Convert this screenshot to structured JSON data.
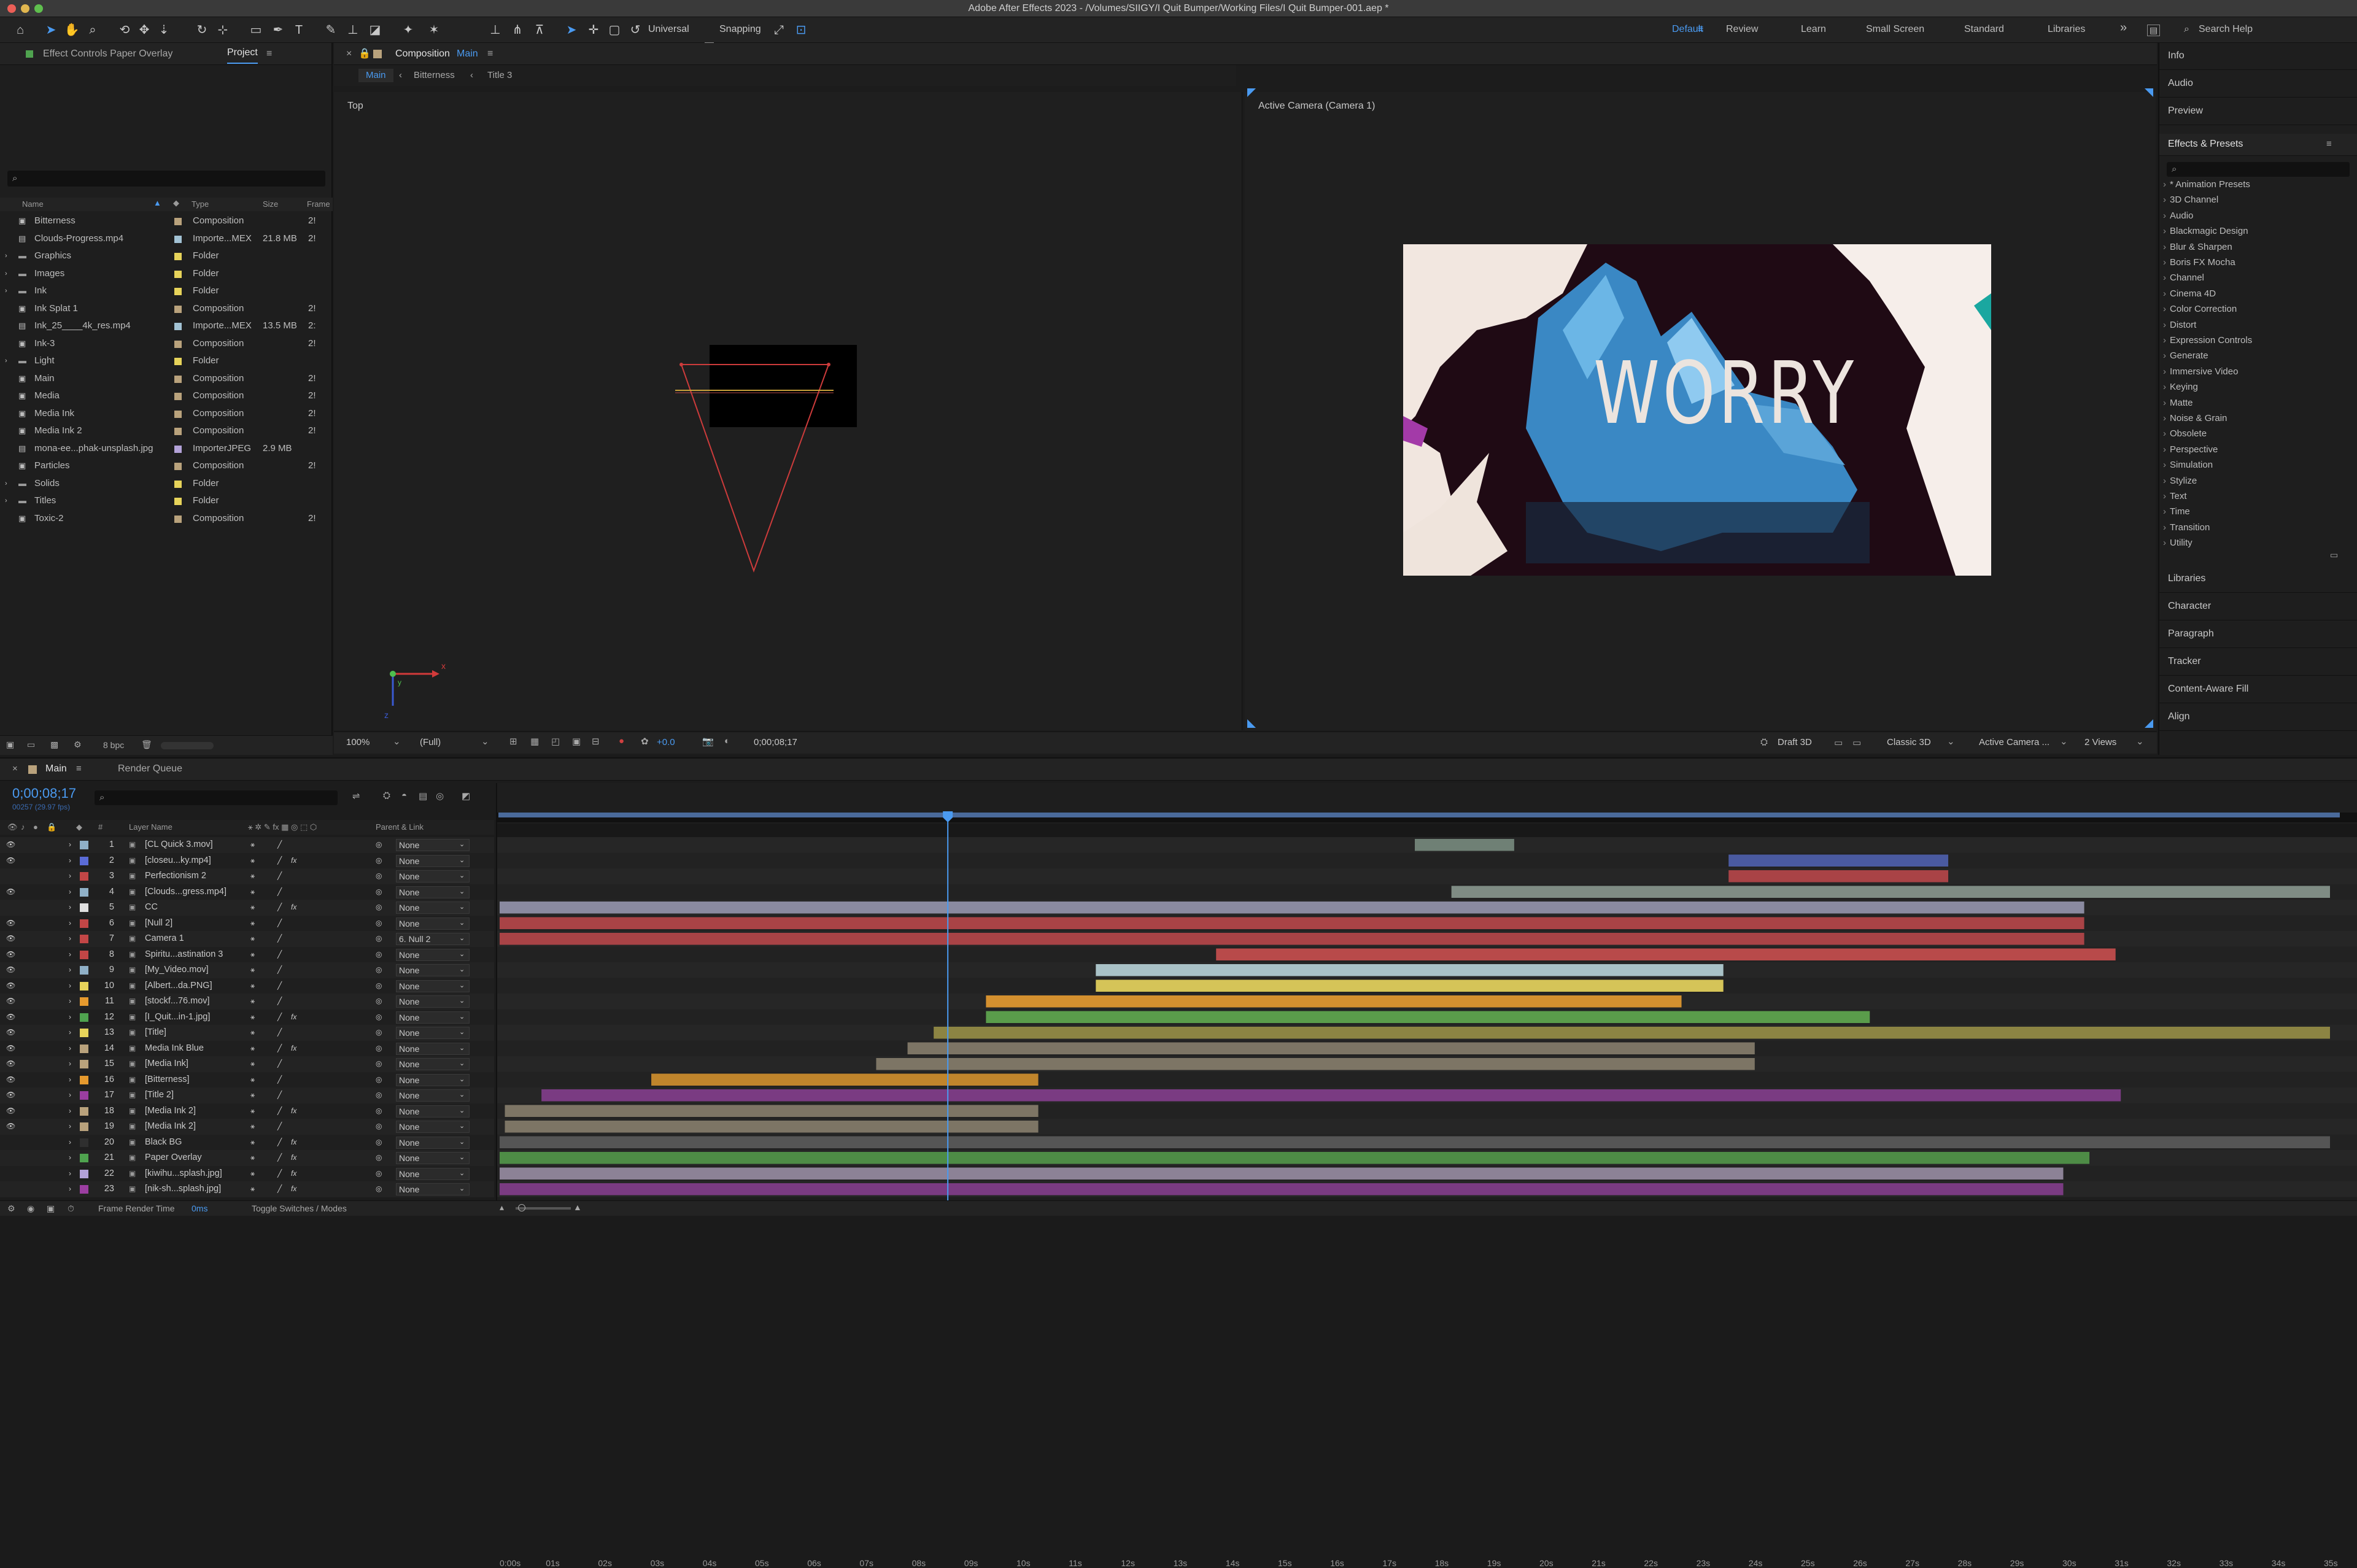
{
  "window": {
    "title": "Adobe After Effects 2023 - /Volumes/SIIGY/I Quit Bumper/Working Files/I Quit Bumper-001.aep *"
  },
  "toolbar": {
    "universal": "Universal",
    "snapping": "Snapping",
    "workspaces": [
      "Default",
      "Review",
      "Learn",
      "Small Screen",
      "Standard",
      "Libraries"
    ],
    "search_placeholder": "Search Help"
  },
  "left_panel": {
    "tab_effect_controls": "Effect Controls Paper Overlay",
    "tab_project": "Project",
    "columns": [
      "Name",
      "Type",
      "Size",
      "Frame"
    ],
    "bpc": "8 bpc",
    "items": [
      {
        "name": "Bitterness",
        "type": "Composition",
        "size": "",
        "frame": "2!",
        "color": "#b9a27c",
        "kind": "comp"
      },
      {
        "name": "Clouds-Progress.mp4",
        "type": "Importe...MEX",
        "size": "21.8 MB",
        "frame": "2!",
        "color": "#a2c2d4",
        "kind": "file"
      },
      {
        "name": "Graphics",
        "type": "Folder",
        "size": "",
        "frame": "",
        "color": "#e6d35a",
        "kind": "folder"
      },
      {
        "name": "Images",
        "type": "Folder",
        "size": "",
        "frame": "",
        "color": "#e6d35a",
        "kind": "folder"
      },
      {
        "name": "Ink",
        "type": "Folder",
        "size": "",
        "frame": "",
        "color": "#e6d35a",
        "kind": "folder"
      },
      {
        "name": "Ink Splat 1",
        "type": "Composition",
        "size": "",
        "frame": "2!",
        "color": "#b9a27c",
        "kind": "comp"
      },
      {
        "name": "Ink_25____4k_res.mp4",
        "type": "Importe...MEX",
        "size": "13.5 MB",
        "frame": "2:",
        "color": "#a2c2d4",
        "kind": "file"
      },
      {
        "name": "Ink-3",
        "type": "Composition",
        "size": "",
        "frame": "2!",
        "color": "#b9a27c",
        "kind": "comp"
      },
      {
        "name": "Light",
        "type": "Folder",
        "size": "",
        "frame": "",
        "color": "#e6d35a",
        "kind": "folder"
      },
      {
        "name": "Main",
        "type": "Composition",
        "size": "",
        "frame": "2!",
        "color": "#b9a27c",
        "kind": "comp"
      },
      {
        "name": "Media",
        "type": "Composition",
        "size": "",
        "frame": "2!",
        "color": "#b9a27c",
        "kind": "comp"
      },
      {
        "name": "Media Ink",
        "type": "Composition",
        "size": "",
        "frame": "2!",
        "color": "#b9a27c",
        "kind": "comp"
      },
      {
        "name": "Media Ink 2",
        "type": "Composition",
        "size": "",
        "frame": "2!",
        "color": "#b9a27c",
        "kind": "comp"
      },
      {
        "name": "mona-ee...phak-unsplash.jpg",
        "type": "ImporterJPEG",
        "size": "2.9 MB",
        "frame": "",
        "color": "#b3a2d8",
        "kind": "file"
      },
      {
        "name": "Particles",
        "type": "Composition",
        "size": "",
        "frame": "2!",
        "color": "#b9a27c",
        "kind": "comp"
      },
      {
        "name": "Solids",
        "type": "Folder",
        "size": "",
        "frame": "",
        "color": "#e6d35a",
        "kind": "folder"
      },
      {
        "name": "Titles",
        "type": "Folder",
        "size": "",
        "frame": "",
        "color": "#e6d35a",
        "kind": "folder"
      },
      {
        "name": "Toxic-2",
        "type": "Composition",
        "size": "",
        "frame": "2!",
        "color": "#b9a27c",
        "kind": "comp"
      }
    ]
  },
  "comp_panel": {
    "tab_prefix": "Composition",
    "comp_name": "Main",
    "breadcrumbs": [
      "Main",
      "Bitterness",
      "Title 3"
    ],
    "view_left": "Top",
    "view_right": "Active Camera (Camera 1)",
    "worry_text": "WORRY",
    "footer": {
      "zoom": "100%",
      "resolution": "(Full)",
      "exposure": "+0.0",
      "timecode": "0;00;08;17",
      "draft": "Draft 3D",
      "renderer": "Classic 3D",
      "camera": "Active Camera ...",
      "views": "2 Views"
    }
  },
  "right_panel": {
    "top": [
      "Info",
      "Audio",
      "Preview"
    ],
    "effects_title": "Effects & Presets",
    "effects": [
      "* Animation Presets",
      "3D Channel",
      "Audio",
      "Blackmagic Design",
      "Blur & Sharpen",
      "Boris FX Mocha",
      "Channel",
      "Cinema 4D",
      "Color Correction",
      "Distort",
      "Expression Controls",
      "Generate",
      "Immersive Video",
      "Keying",
      "Matte",
      "Noise & Grain",
      "Obsolete",
      "Perspective",
      "Simulation",
      "Stylize",
      "Text",
      "Time",
      "Transition",
      "Utility"
    ],
    "bottom": [
      "Libraries",
      "Character",
      "Paragraph",
      "Tracker",
      "Content-Aware Fill",
      "Align"
    ]
  },
  "timeline": {
    "tab_main": "Main",
    "tab_render": "Render Queue",
    "timecode": "0;00;08;17",
    "fps": "00257 (29.97 fps)",
    "col_num": "#",
    "col_layer": "Layer Name",
    "col_parent": "Parent & Link",
    "ruler": [
      "0:00s",
      "01s",
      "02s",
      "03s",
      "04s",
      "05s",
      "06s",
      "07s",
      "08s",
      "09s",
      "10s",
      "11s",
      "12s",
      "13s",
      "14s",
      "15s",
      "16s",
      "17s",
      "18s",
      "19s",
      "20s",
      "21s",
      "22s",
      "23s",
      "24s",
      "25s",
      "26s",
      "27s",
      "28s",
      "29s",
      "30s",
      "31s",
      "32s",
      "33s",
      "34s",
      "35s"
    ],
    "playhead_sec": 8.57,
    "duration_sec": 35,
    "layers": [
      {
        "n": "1",
        "name": "[CL Quick 3.mov]",
        "color": "#8fb0c7",
        "parent": "None",
        "in": 17.5,
        "out": 19.4,
        "bar": "#6f8075"
      },
      {
        "n": "2",
        "name": "[closeu...ky.mp4]",
        "color": "#5a6bd6",
        "parent": "None",
        "in": 23.5,
        "out": 27.7,
        "bar": "#4a5aa0",
        "fx": "fx"
      },
      {
        "n": "3",
        "name": "Perfectionism 2",
        "color": "#c24646",
        "parent": "None",
        "in": 23.5,
        "out": 27.7,
        "bar": "#a94346"
      },
      {
        "n": "4",
        "name": "[Clouds...gress.mp4]",
        "color": "#8fb0c7",
        "parent": "None",
        "in": 18.2,
        "out": 35,
        "bar": "#7f8c84"
      },
      {
        "n": "5",
        "name": "CC",
        "color": "#e0e0e0",
        "parent": "None",
        "in": 0,
        "out": 30.3,
        "bar": "#8a8aa0",
        "fx": "fx"
      },
      {
        "n": "6",
        "name": "[Null 2]",
        "color": "#c24646",
        "parent": "None",
        "in": 0,
        "out": 30.3,
        "bar": "#a94346"
      },
      {
        "n": "7",
        "name": "Camera 1",
        "color": "#c24646",
        "parent": "6. Null 2",
        "in": 0,
        "out": 30.3,
        "bar": "#a94346"
      },
      {
        "n": "8",
        "name": "Spiritu...astination 3",
        "color": "#c24646",
        "parent": "None",
        "in": 13.7,
        "out": 30.9,
        "bar": "#b84a4a"
      },
      {
        "n": "9",
        "name": "[My_Video.mov]",
        "color": "#8fb0c7",
        "parent": "None",
        "in": 11.4,
        "out": 23.4,
        "bar": "#a9c2c7"
      },
      {
        "n": "10",
        "name": "[Albert...da.PNG]",
        "color": "#e6d35a",
        "parent": "None",
        "in": 11.4,
        "out": 23.4,
        "bar": "#d5c458"
      },
      {
        "n": "11",
        "name": "[stockf...76.mov]",
        "color": "#e69a2e",
        "parent": "None",
        "in": 9.3,
        "out": 22.6,
        "bar": "#d4902f"
      },
      {
        "n": "12",
        "name": "[I_Quit...in-1.jpg]",
        "color": "#4fa34f",
        "parent": "None",
        "in": 9.3,
        "out": 26.2,
        "bar": "#5a9c4b",
        "fx": "fx"
      },
      {
        "n": "13",
        "name": "[Title]",
        "color": "#e6d35a",
        "parent": "None",
        "in": 8.3,
        "out": 35,
        "bar": "#8c8443"
      },
      {
        "n": "14",
        "name": "Media Ink Blue",
        "color": "#b9a27c",
        "parent": "None",
        "in": 7.8,
        "out": 24,
        "bar": "#7d7565",
        "fx": "fx"
      },
      {
        "n": "15",
        "name": "[Media Ink]",
        "color": "#b9a27c",
        "parent": "None",
        "in": 7.2,
        "out": 24,
        "bar": "#7d7565"
      },
      {
        "n": "16",
        "name": "[Bitterness]",
        "color": "#e69a2e",
        "parent": "None",
        "in": 2.9,
        "out": 10.3,
        "bar": "#c0852c"
      },
      {
        "n": "17",
        "name": "[Title 2]",
        "color": "#9b3ea1",
        "parent": "None",
        "in": 0.8,
        "out": 31,
        "bar": "#7a3b82"
      },
      {
        "n": "18",
        "name": "[Media Ink 2]",
        "color": "#b9a27c",
        "parent": "None",
        "in": 0.1,
        "out": 10.3,
        "bar": "#7d7565",
        "fx": "fx"
      },
      {
        "n": "19",
        "name": "[Media Ink 2]",
        "color": "#b9a27c",
        "parent": "None",
        "in": 0.1,
        "out": 10.3,
        "bar": "#7d7565"
      },
      {
        "n": "20",
        "name": "Black BG",
        "color": "#2f2f2f",
        "parent": "None",
        "in": 0,
        "out": 35,
        "bar": "#555555",
        "fx": "fx"
      },
      {
        "n": "21",
        "name": "Paper Overlay",
        "color": "#4fa34f",
        "parent": "None",
        "in": 0,
        "out": 30.4,
        "bar": "#4e8c46",
        "fx": "fx"
      },
      {
        "n": "22",
        "name": "[kiwihu...splash.jpg]",
        "color": "#b3a2d8",
        "parent": "None",
        "in": 0,
        "out": 29.9,
        "bar": "#8c8296",
        "fx": "fx"
      },
      {
        "n": "23",
        "name": "[nik-sh...splash.jpg]",
        "color": "#9b3ea1",
        "parent": "None",
        "in": 0,
        "out": 29.9,
        "bar": "#7a3b82",
        "fx": "fx"
      }
    ],
    "footer": {
      "render_time_label": "Frame Render Time",
      "render_time": "0ms",
      "toggle": "Toggle Switches / Modes"
    }
  }
}
